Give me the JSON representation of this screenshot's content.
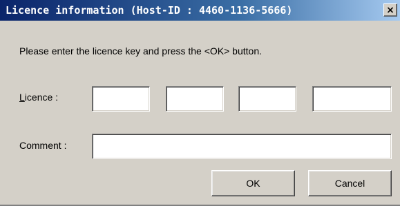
{
  "window": {
    "title": "Licence information (Host-ID : 4460-1136-5666)",
    "close_glyph": "×"
  },
  "instruction": "Please enter the licence key and press the <OK> button.",
  "licence": {
    "label_mnemonic": "L",
    "label_rest": "icence :",
    "fields": [
      "",
      "",
      "",
      ""
    ]
  },
  "comment": {
    "label": "Comment :",
    "value": ""
  },
  "buttons": {
    "ok_label": "OK",
    "cancel_label": "Cancel"
  },
  "colors": {
    "titlebar_start": "#0a246a",
    "titlebar_end": "#a6caf0",
    "dialog_background": "#d4d0c8"
  }
}
